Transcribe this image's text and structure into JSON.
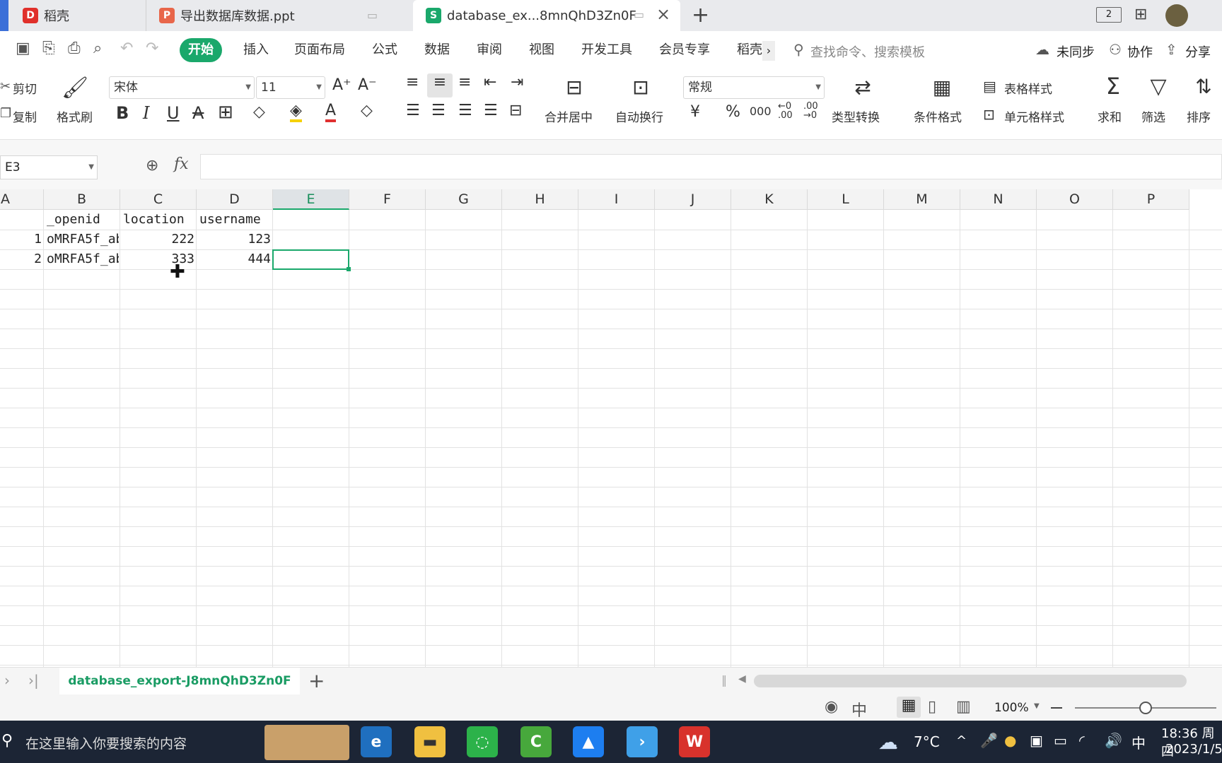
{
  "tabs": [
    {
      "label": "稻壳",
      "icon": "docer-icon",
      "color": "#e0302b"
    },
    {
      "label": "导出数据库数据.ppt",
      "icon": "ppt-icon",
      "color": "#e8664a"
    },
    {
      "label": "database_ex...8mnQhD3Zn0F",
      "icon": "sheet-icon",
      "color": "#1aa86b"
    }
  ],
  "menu": {
    "items": [
      "开始",
      "插入",
      "页面布局",
      "公式",
      "数据",
      "审阅",
      "视图",
      "开发工具",
      "会员专享",
      "稻壳"
    ],
    "search_placeholder": "查找命令、搜索模板",
    "sync": "未同步",
    "collab": "协作",
    "share": "分享"
  },
  "ribbon": {
    "cut": "剪切",
    "copy": "复制",
    "format_painter": "格式刷",
    "font": "宋体",
    "size": "11",
    "merge": "合并居中",
    "wrap": "自动换行",
    "number_format": "常规",
    "type_convert": "类型转换",
    "cond_format": "条件格式",
    "table_style": "表格样式",
    "cell_style": "单元格样式",
    "sum": "求和",
    "filter": "筛选",
    "sort": "排序",
    "currency_symbol": "¥",
    "percent_symbol": "%",
    "thousands_symbol": "000",
    "inc_decimal": "←0 .00",
    "dec_decimal": ".00 →0"
  },
  "formula": {
    "namebox": "E3",
    "fx": "fx",
    "value": ""
  },
  "columns": [
    "A",
    "B",
    "C",
    "D",
    "E",
    "F",
    "G",
    "H",
    "I",
    "J",
    "K",
    "L",
    "M",
    "N",
    "O",
    "P"
  ],
  "selected_column": "E",
  "rows": [
    {
      "A": "",
      "B": "_openid",
      "C": "location",
      "D": "username"
    },
    {
      "A": "1",
      "B": "oMRFA5f_ab",
      "C": "222",
      "D": "123"
    },
    {
      "A": "2",
      "B": "oMRFA5f_ab",
      "C": "333",
      "D": "444"
    }
  ],
  "sheet": {
    "name": "database_export-J8mnQhD3Zn0F",
    "add": "+"
  },
  "status": {
    "zoom": "100%"
  },
  "taskbar": {
    "search": "在这里输入你要搜索的内容",
    "temp": "7°C",
    "ime": "中",
    "time": "18:36 周四",
    "date": "2023/1/5"
  }
}
